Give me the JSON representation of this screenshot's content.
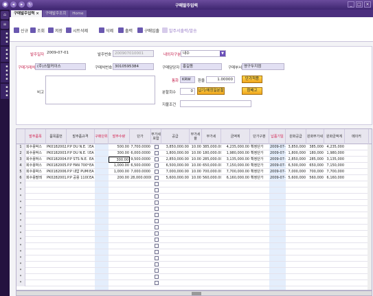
{
  "window": {
    "title": "구매발주입력"
  },
  "tabs": [
    "구매발주입력 ×",
    "구매발주조회",
    "Home"
  ],
  "toolbar": {
    "new": "신규",
    "search": "조회",
    "save": "저장",
    "delete_sheet": "시트삭제",
    "delete": "삭제",
    "print": "출력",
    "purchase_register": "구매입출",
    "purchase_order_print": "발주서출력/발송"
  },
  "form": {
    "order_date_label": "발주일자",
    "order_date": "2009-07-01",
    "order_no_label": "발주번호",
    "order_no": "200907010001",
    "domestic_label": "내외자구분",
    "domestic": "내수",
    "customer_label": "구매거래처",
    "customer": "(주)스탈커이스",
    "biz_no_label": "구매처번호",
    "biz_no": "3010595384",
    "manager_label": "구매담당자",
    "manager": "홍길동",
    "dept_label": "구매부서",
    "dept": "영구두지점",
    "remark_label": "비고",
    "currency_label": "통화",
    "currency": "KRW",
    "rate_label": "환율",
    "rate": "1.00000",
    "unit_price_btn": "단가적용",
    "split_label": "분할회수",
    "split_value": "0",
    "split_btn": "납기/에정일분할",
    "reference_btn": "참배고",
    "payment_label": "지불조건"
  },
  "grid": {
    "headers": [
      "발주품목",
      "품목품번",
      "발주품규격",
      "구매단위",
      "발주수량",
      "단가",
      "부가세포함",
      "공급",
      "부가세율",
      "부가세",
      "금액계",
      "단가구분",
      "납품기일",
      "원화공급",
      "원화부가세",
      "원화금액계",
      "메이커"
    ],
    "rows": [
      {
        "n": "1",
        "item": "회수용박스",
        "code": "PK0182002A",
        "spec": "P.P DU N.E. 7",
        "unit": "EA",
        "qty": "500.00",
        "price": "7,700.0000",
        "supply": "3,850,000.00",
        "vat_rate": "10.00",
        "vat": "385,000.00",
        "total": "4,235,000.00",
        "ptype": "확정단가",
        "date": "2009-07-01",
        "ksupply": "3,850,000",
        "kvat": "385,000",
        "ktotal": "4,235,000"
      },
      {
        "n": "2",
        "item": "회수용박스",
        "code": "PK0182003A",
        "spec": "P.P DU N.E. 9",
        "unit": "EA",
        "qty": "300.00",
        "price": "6,000.0000",
        "supply": "1,800,000.00",
        "vat_rate": "10.00",
        "vat": "180,000.00",
        "total": "1,980,000.00",
        "ptype": "확정단가",
        "date": "2009-07-01",
        "ksupply": "1,800,000",
        "kvat": "180,000",
        "ktotal": "1,980,000"
      },
      {
        "n": "3",
        "item": "회수용박스",
        "code": "PK0182004A",
        "spec": "P.P STS N.E.",
        "unit": "EA",
        "qty": "300.00",
        "price": "9,500.0000",
        "supply": "2,850,000.00",
        "vat_rate": "10.00",
        "vat": "285,000.00",
        "total": "3,135,000.00",
        "ptype": "확정단가",
        "date": "2009-07-01",
        "ksupply": "2,850,000",
        "kvat": "285,000",
        "ktotal": "3,135,000"
      },
      {
        "n": "4",
        "item": "회수용박스",
        "code": "PK0182005A",
        "spec": "P.P FAN 700*3",
        "unit": "EA",
        "qty": "1,000.00",
        "price": "6,500.0000",
        "supply": "6,500,000.00",
        "vat_rate": "10.00",
        "vat": "650,000.00",
        "total": "7,150,000.00",
        "ptype": "확정단가",
        "date": "2009-07-01",
        "ksupply": "6,500,000",
        "kvat": "650,000",
        "ktotal": "7,150,000"
      },
      {
        "n": "5",
        "item": "회수용박스",
        "code": "PK0182006A",
        "spec": "P.P 내압 PUMP",
        "unit": "EA",
        "qty": "1,000.00",
        "price": "7,000.0000",
        "supply": "7,000,000.00",
        "vat_rate": "10.00",
        "vat": "700,000.00",
        "total": "7,700,000.00",
        "ptype": "확정단가",
        "date": "2009-07-01",
        "ksupply": "7,000,000",
        "kvat": "700,000",
        "ktotal": "7,700,000"
      },
      {
        "n": "6",
        "item": "회수용팔레",
        "code": "PK0282001A",
        "spec": "P.P 공용 1100",
        "unit": "EA",
        "qty": "200.00",
        "price": "28,000.0000",
        "supply": "5,600,000.00",
        "vat_rate": "10.00",
        "vat": "560,000.00",
        "total": "6,160,000.00",
        "ptype": "확정단가",
        "date": "2009-07-01",
        "ksupply": "5,600,000",
        "kvat": "560,000",
        "ktotal": "6,160,000"
      }
    ],
    "empty_marker": "*"
  }
}
